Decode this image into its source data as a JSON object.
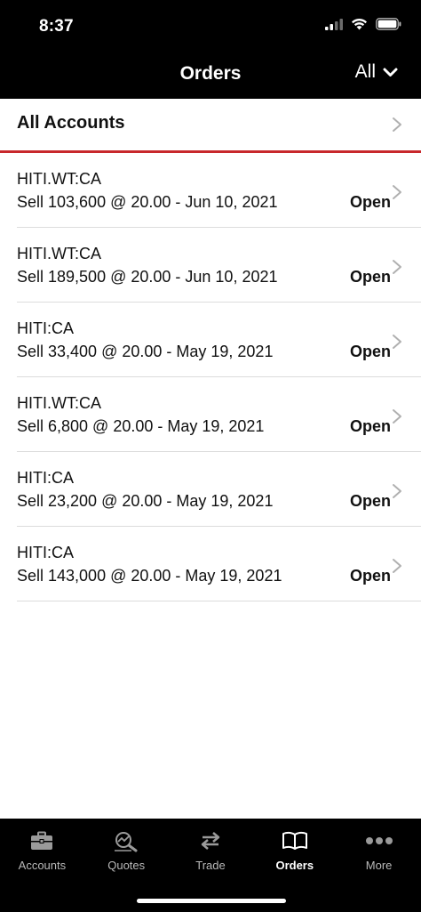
{
  "status_bar": {
    "time": "8:37"
  },
  "header": {
    "title": "Orders",
    "filter_label": "All",
    "filter_icon": "chevron-down-icon"
  },
  "accounts": {
    "label": "All Accounts"
  },
  "orders": [
    {
      "symbol": "HITI.WT:CA",
      "detail": "Sell 103,600 @ 20.00 - Jun 10, 2021",
      "status": "Open"
    },
    {
      "symbol": "HITI.WT:CA",
      "detail": "Sell 189,500 @ 20.00 - Jun 10, 2021",
      "status": "Open"
    },
    {
      "symbol": "HITI:CA",
      "detail": "Sell 33,400 @ 20.00 - May 19, 2021",
      "status": "Open"
    },
    {
      "symbol": "HITI.WT:CA",
      "detail": "Sell 6,800 @ 20.00 - May 19, 2021",
      "status": "Open"
    },
    {
      "symbol": "HITI:CA",
      "detail": "Sell 23,200 @ 20.00 - May 19, 2021",
      "status": "Open"
    },
    {
      "symbol": "HITI:CA",
      "detail": "Sell 143,000 @ 20.00 - May 19, 2021",
      "status": "Open"
    }
  ],
  "tabs": [
    {
      "label": "Accounts",
      "icon": "briefcase-icon",
      "active": false
    },
    {
      "label": "Quotes",
      "icon": "quotes-magnifier-icon",
      "active": false
    },
    {
      "label": "Trade",
      "icon": "swap-arrows-icon",
      "active": false
    },
    {
      "label": "Orders",
      "icon": "open-book-icon",
      "active": true
    },
    {
      "label": "More",
      "icon": "more-dots-icon",
      "active": false
    }
  ],
  "colors": {
    "header_bg": "#000000",
    "accent_rule": "#c8282c",
    "separator": "#dcdcdc"
  }
}
